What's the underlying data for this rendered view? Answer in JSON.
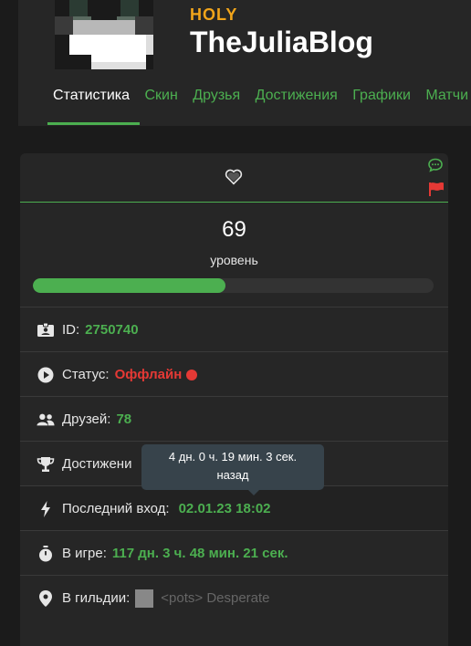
{
  "profile": {
    "guild_tag": "HOLY",
    "username": "TheJuliaBlog"
  },
  "tabs": [
    "Статистика",
    "Скин",
    "Друзья",
    "Достижения",
    "Графики",
    "Матчи"
  ],
  "level": {
    "value": "69",
    "label": "уровень",
    "progress": 0.48
  },
  "stats": {
    "id_label": "ID:",
    "id_value": "2750740",
    "status_label": "Статус:",
    "status_value": "Оффлайн",
    "friends_label": "Друзей:",
    "friends_value": "78",
    "achievements_label": "Достижени",
    "last_login_label": "Последний вход:",
    "last_login_value": "02.01.23 18:02",
    "playtime_label": "В игре:",
    "playtime_value": "117 дн. 3 ч. 48 мин. 21 сек.",
    "guild_label": "В гильдии:",
    "guild_value": "<pots> Desperate"
  },
  "tooltip": {
    "line1": "4 дн. 0 ч. 19 мин. 3 сек.",
    "line2": "назад"
  },
  "colors": {
    "accent": "#4caf50",
    "guild_tag": "#f2a51a",
    "offline": "#e53935"
  }
}
